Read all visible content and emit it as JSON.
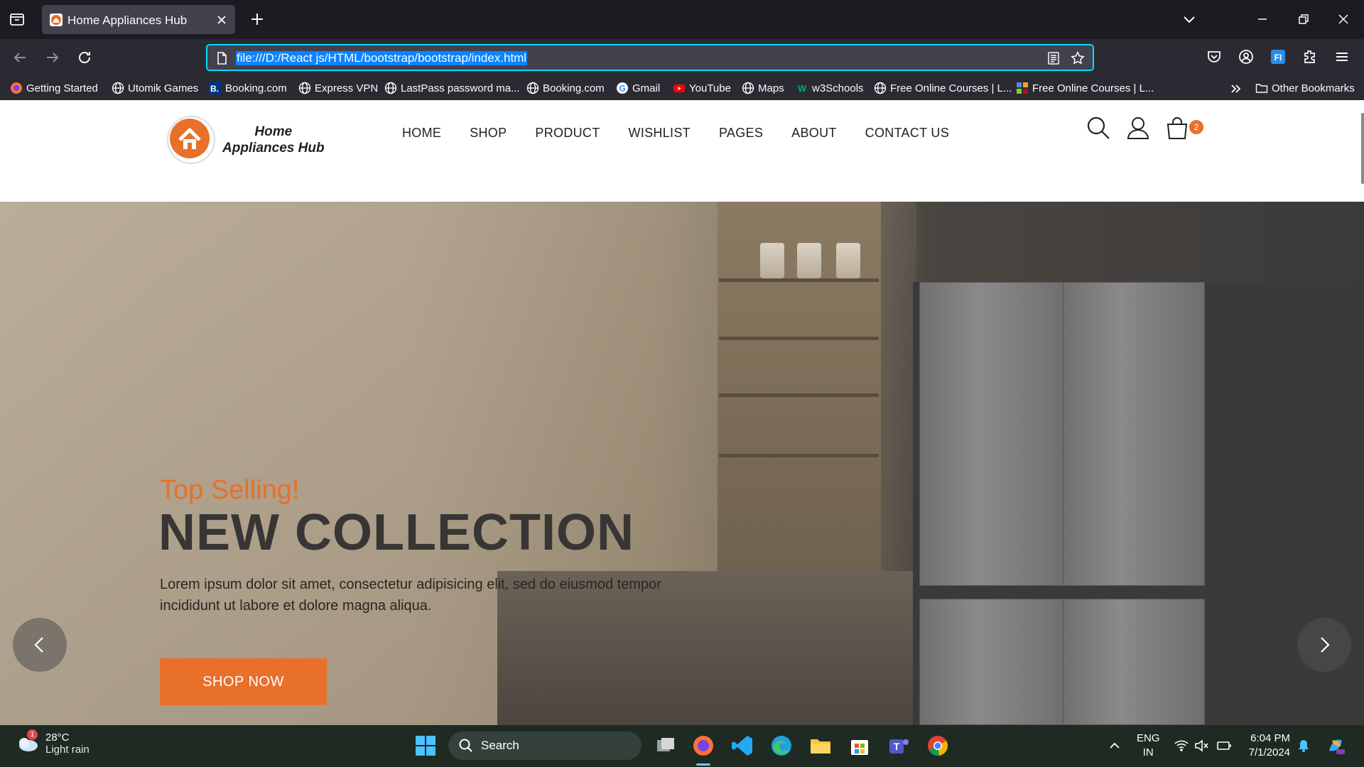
{
  "browser": {
    "tab_title": "Home Appliances Hub",
    "url": "file:///D:/React js/HTML/bootstrap/bootstrap/index.html",
    "bookmarks": [
      {
        "label": "Getting Started",
        "icon": "firefox-icon"
      },
      {
        "label": "Utomik Games",
        "icon": "globe-icon"
      },
      {
        "label": "Booking.com",
        "icon": "booking-icon"
      },
      {
        "label": "Express VPN",
        "icon": "globe-icon"
      },
      {
        "label": "LastPass password ma...",
        "icon": "globe-icon"
      },
      {
        "label": "Booking.com",
        "icon": "globe-icon"
      },
      {
        "label": "Gmail",
        "icon": "google-icon"
      },
      {
        "label": "YouTube",
        "icon": "youtube-icon"
      },
      {
        "label": "Maps",
        "icon": "globe-icon"
      },
      {
        "label": "w3Schools",
        "icon": "w3schools-icon"
      },
      {
        "label": "Free Online Courses | L...",
        "icon": "globe-icon"
      },
      {
        "label": "Free Online Courses | L...",
        "icon": "courses-icon"
      }
    ],
    "other_bookmarks": "Other Bookmarks"
  },
  "site": {
    "logo_line1": "Home",
    "logo_line2": "Appliances Hub",
    "menu": [
      "HOME",
      "SHOP",
      "PRODUCT",
      "WISHLIST",
      "PAGES",
      "ABOUT",
      "CONTACT US"
    ],
    "cart_count": "2",
    "accent_color": "#e8702a"
  },
  "hero": {
    "subtitle": "Top Selling!",
    "title": "NEW COLLECTION",
    "text": "Lorem ipsum dolor sit amet, consectetur adipisicing elit, sed do eiusmod tempor incididunt ut labore et dolore magna aliqua.",
    "button": "SHOP NOW"
  },
  "taskbar": {
    "weather_temp": "28°C",
    "weather_desc": "Light rain",
    "weather_badge": "1",
    "search_label": "Search",
    "lang_line1": "ENG",
    "lang_line2": "IN",
    "time": "6:04 PM",
    "date": "7/1/2024"
  }
}
